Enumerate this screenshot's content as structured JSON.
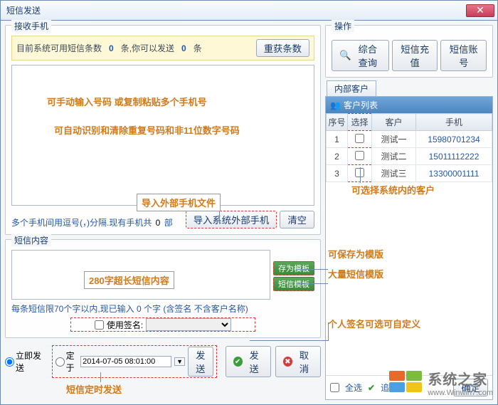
{
  "title": "短信发送",
  "receive": {
    "group": "接收手机",
    "info_prefix": "目前系统可用短信条数",
    "info_count": "0",
    "info_unit1": "条,你可以发送",
    "info_send": "0",
    "info_unit2": "条",
    "btn_refresh": "重获条数",
    "annot1": "可手动输入号码 或复制粘贴多个手机号",
    "annot2": "可自动识别和清除重复号码和非11位数字号码",
    "annot_import": "导入外部手机文件",
    "hint_prefix": "多个手机间用逗号(，)分隔.现有手机共",
    "hint_count": "0",
    "hint_suffix": "部",
    "btn_import": "导入系统外部手机",
    "btn_clear": "清空"
  },
  "content": {
    "group": "短信内容",
    "annot_long": "280字超长短信内容",
    "btn_save_tpl": "存为模板",
    "btn_sms_tpl": "短信模板",
    "hint": "每条短信限70个字以内,现已输入 0 个字 (含签名 不含客户名称)",
    "sign_label": "使用签名:",
    "annot_save_tpl": "可保存为模版",
    "annot_many_tpl": "大量短信模版",
    "annot_sign": "个人签名可选可自定义"
  },
  "send": {
    "radio_now": "立即发送",
    "radio_at": "定于",
    "time": "2014-07-05 08:01:00",
    "btn_submit": "发送",
    "btn_send": "发送",
    "btn_cancel": "取消",
    "annot_timer": "短信定时发送"
  },
  "ops": {
    "group": "操作",
    "btn_query": "综合查询",
    "btn_recharge": "短信充值",
    "btn_account": "短信账号"
  },
  "customers": {
    "tab": "内部客户",
    "panel_title": "客户列表",
    "cols": {
      "idx": "序号",
      "sel": "选择",
      "name": "客户",
      "phone": "手机"
    },
    "rows": [
      {
        "idx": "1",
        "name": "测试一",
        "phone": "15980701234"
      },
      {
        "idx": "2",
        "name": "测试二",
        "phone": "15011112222"
      },
      {
        "idx": "3",
        "name": "测试三",
        "phone": "13300001111"
      }
    ],
    "annot_select": "可选择系统内的客户",
    "select_all": "全选",
    "add": "追加",
    "confirm": "确定"
  },
  "watermark": {
    "brand": "系统之家",
    "url": "www.Winwin7.com"
  }
}
